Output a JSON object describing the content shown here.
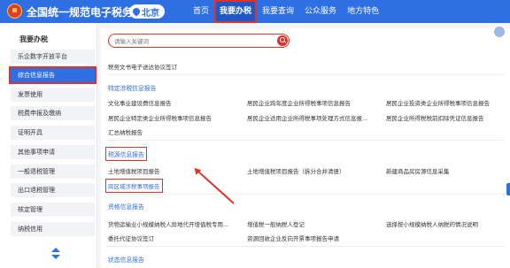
{
  "header": {
    "site_title": "全国统一规范电子税务局",
    "region": "北京",
    "nav": [
      "首页",
      "我要办税",
      "我要查询",
      "公众服务",
      "地方特色"
    ]
  },
  "sidebar": {
    "title": "我要办税",
    "items": [
      "乐企数字开放平台",
      "综合信息报告",
      "发票使用",
      "税费申报及缴纳",
      "证明开具",
      "其他事项申请",
      "一般退税管理",
      "出口退税管理",
      "核定管理",
      "纳税信用"
    ]
  },
  "search": {
    "placeholder": "请输入关键词"
  },
  "content": {
    "top_link": "税务文书电子送达协议签订",
    "sec1": {
      "title": "特定涉税信息报告",
      "links": [
        "文化事业建设费信息报告",
        "居民企业跨年度企业所得税事项信息报告",
        "居民企业投资类企业所得税事项信息报告",
        "居民企业特定类企业所得税事项信息报告",
        "居民企业适用企业所得税事项处理方式信息报...",
        "居民企业所得税税前扣除凭证信息报告",
        "汇总纳税报告"
      ]
    },
    "sec2": {
      "title": "税源信息报告",
      "links": [
        "土地增值税项目报告",
        "土地增值税项目报告（拆分合并清册）",
        "新建商品房房源信息采集",
        "跨区域涉税事项报告"
      ]
    },
    "sec3": {
      "title": "资格信息报告",
      "links": [
        "货物运输业小规模纳税人异地代开增值税专用...",
        "增值税一般纳税人登记",
        "选择按小规模纳税人纳税的情况说明",
        "委托代征协议签订",
        "资源回收企业反向开票事项报告申请"
      ]
    },
    "sec4": {
      "title": "状态信息报告"
    }
  }
}
